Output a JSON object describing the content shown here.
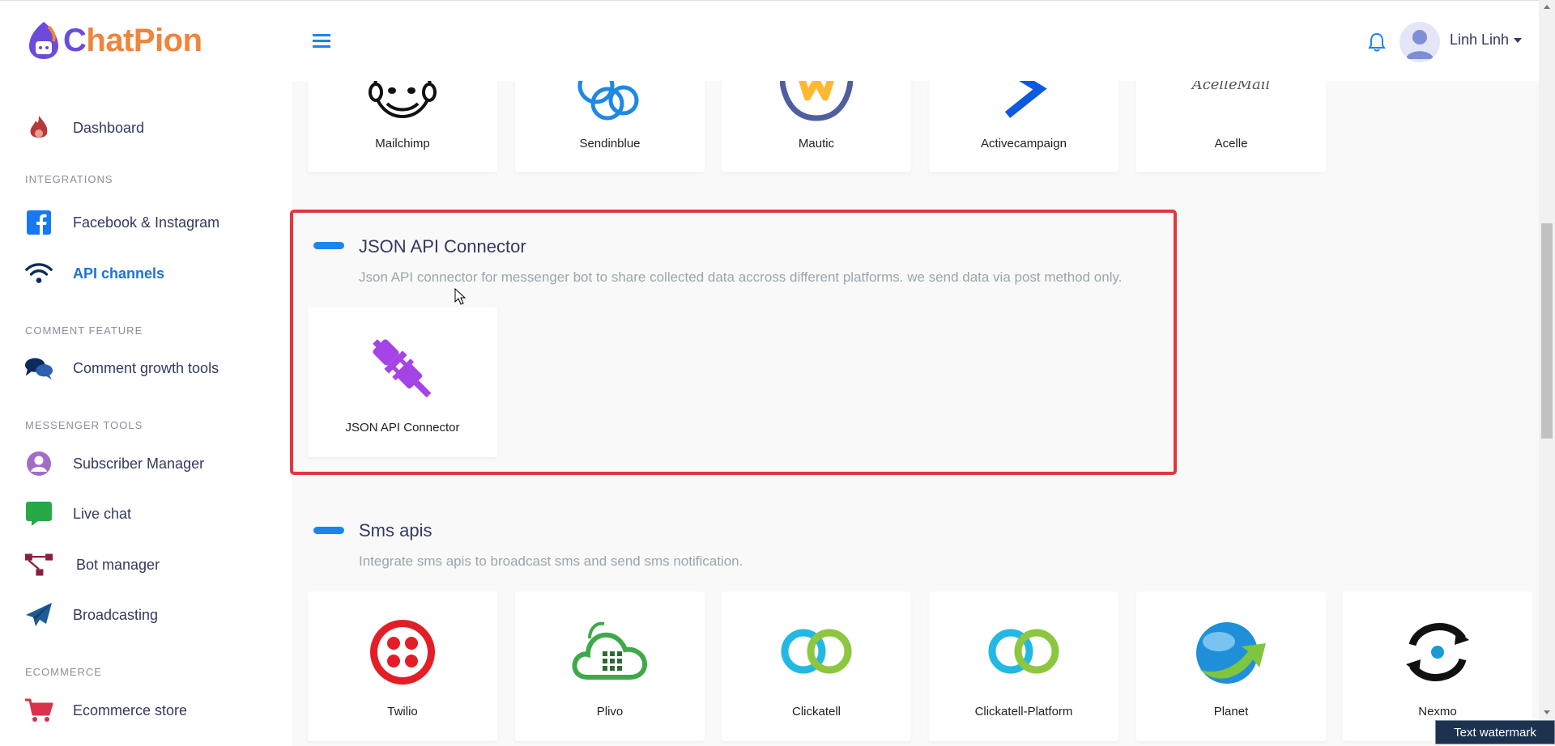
{
  "brand": {
    "logo_letter": "C",
    "logo_rest": "hatPion",
    "accent": "#6c4bdc",
    "accent2": "#f0843a"
  },
  "topbar": {
    "menu_icon": "hamburger-icon",
    "bell_icon": "bell-icon",
    "user_name": "Linh Linh"
  },
  "sidebar": {
    "dashboard": "Dashboard",
    "integrations_heading": "INTEGRATIONS",
    "facebook": "Facebook & Instagram",
    "api_channels": "API channels",
    "comment_heading": "COMMENT FEATURE",
    "comment_tools": "Comment growth tools",
    "messenger_heading": "MESSENGER TOOLS",
    "subscriber_manager": "Subscriber Manager",
    "live_chat": "Live chat",
    "bot_manager": "Bot manager",
    "broadcasting": "Broadcasting",
    "ecommerce_heading": "ECOMMERCE",
    "ecommerce_store": "Ecommerce store"
  },
  "email_cards": [
    "Mailchimp",
    "Sendinblue",
    "Mautic",
    "Activecampaign",
    "Acelle"
  ],
  "acelle_logo_text": "AcelleMail",
  "json_section": {
    "title": "JSON API Connector",
    "description": "Json API connector for messenger bot to share collected data accross different platforms. we send data via post method only.",
    "card_label": "JSON API Connector"
  },
  "sms_section": {
    "title": "Sms apis",
    "description": "Integrate sms apis to broadcast sms and send sms notification.",
    "cards": [
      "Twilio",
      "Plivo",
      "Clickatell",
      "Clickatell-Platform",
      "Planet",
      "Nexmo"
    ]
  },
  "watermark": "Text watermark"
}
